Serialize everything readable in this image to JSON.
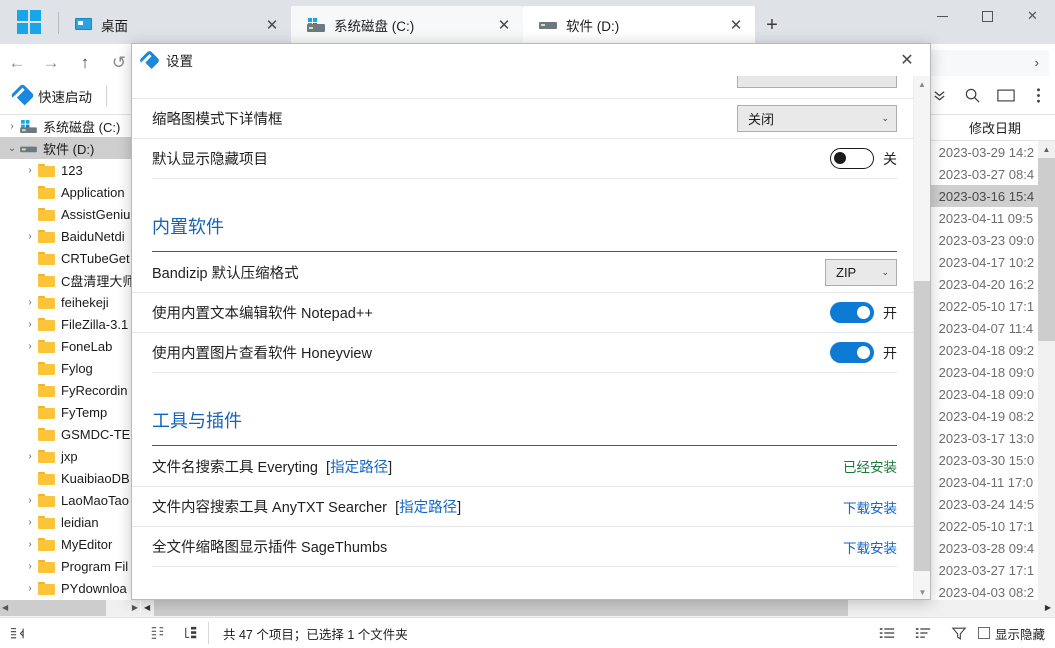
{
  "window": {
    "logo": "windows-grid-logo",
    "tabs": [
      {
        "label": "桌面",
        "icon": "desktop-icon",
        "state": "inactive",
        "close": "✕"
      },
      {
        "label": "系统磁盘 (C:)",
        "icon": "system-drive-icon",
        "state": "inactive-hl",
        "close": "✕"
      },
      {
        "label": "软件 (D:)",
        "icon": "drive-icon",
        "state": "active",
        "close": "✕"
      }
    ],
    "new_tab_label": "+",
    "controls": {
      "minimize": "minimize-icon",
      "maximize": "maximize-icon",
      "close": "✕"
    }
  },
  "toolbar": {
    "back": "←",
    "forward": "→",
    "up": "↑",
    "refresh": "↺",
    "address_chevron": "›"
  },
  "quicklaunch": {
    "label": "快速启动",
    "icons": {
      "expand": "chevron-double-down-icon",
      "search": "search-icon",
      "preview": "preview-pane-icon",
      "more": "more-options-icon"
    }
  },
  "tree": {
    "items": [
      {
        "label": "系统磁盘 (C:)",
        "chev": "›",
        "depth": 0,
        "type": "drive",
        "selected": false
      },
      {
        "label": "软件 (D:)",
        "chev": "⌄",
        "depth": 0,
        "type": "drive",
        "selected": true
      },
      {
        "label": "123",
        "chev": "›",
        "depth": 1,
        "type": "folder",
        "selected": false
      },
      {
        "label": "Application",
        "chev": "",
        "depth": 1,
        "type": "folder",
        "selected": false
      },
      {
        "label": "AssistGeniu",
        "chev": "",
        "depth": 1,
        "type": "folder",
        "selected": false
      },
      {
        "label": "BaiduNetdi",
        "chev": "›",
        "depth": 1,
        "type": "folder",
        "selected": false
      },
      {
        "label": "CRTubeGet",
        "chev": "",
        "depth": 1,
        "type": "folder",
        "selected": false
      },
      {
        "label": "C盘清理大师",
        "chev": "",
        "depth": 1,
        "type": "folder",
        "selected": false
      },
      {
        "label": "feihekeji",
        "chev": "›",
        "depth": 1,
        "type": "folder",
        "selected": false
      },
      {
        "label": "FileZilla-3.1",
        "chev": "›",
        "depth": 1,
        "type": "folder",
        "selected": false
      },
      {
        "label": "FoneLab",
        "chev": "›",
        "depth": 1,
        "type": "folder",
        "selected": false
      },
      {
        "label": "Fylog",
        "chev": "",
        "depth": 1,
        "type": "folder",
        "selected": false
      },
      {
        "label": "FyRecordin",
        "chev": "",
        "depth": 1,
        "type": "folder",
        "selected": false
      },
      {
        "label": "FyTemp",
        "chev": "",
        "depth": 1,
        "type": "folder",
        "selected": false
      },
      {
        "label": "GSMDC-TE",
        "chev": "",
        "depth": 1,
        "type": "folder",
        "selected": false
      },
      {
        "label": "jxp",
        "chev": "›",
        "depth": 1,
        "type": "folder",
        "selected": false
      },
      {
        "label": "KuaibiaoDB",
        "chev": "",
        "depth": 1,
        "type": "folder",
        "selected": false
      },
      {
        "label": "LaoMaoTao",
        "chev": "›",
        "depth": 1,
        "type": "folder",
        "selected": false
      },
      {
        "label": "leidian",
        "chev": "›",
        "depth": 1,
        "type": "folder",
        "selected": false
      },
      {
        "label": "MyEditor",
        "chev": "›",
        "depth": 1,
        "type": "folder",
        "selected": false
      },
      {
        "label": "Program Fil",
        "chev": "›",
        "depth": 1,
        "type": "folder",
        "selected": false
      },
      {
        "label": "PYdownloa",
        "chev": "›",
        "depth": 1,
        "type": "folder",
        "selected": false
      }
    ]
  },
  "filelist": {
    "columns": {
      "name": "",
      "date": "修改日期"
    },
    "rows": [
      {
        "date": "2023-03-29  14:2",
        "selected": false
      },
      {
        "date": "2023-03-27  08:4",
        "selected": false
      },
      {
        "date": "2023-03-16  15:4",
        "selected": true
      },
      {
        "date": "2023-04-11  09:5",
        "selected": false
      },
      {
        "date": "2023-03-23  09:0",
        "selected": false
      },
      {
        "date": "2023-04-17  10:2",
        "selected": false
      },
      {
        "date": "2023-04-20  16:2",
        "selected": false
      },
      {
        "date": "2022-05-10  17:1",
        "selected": false
      },
      {
        "date": "2023-04-07  11:4",
        "selected": false
      },
      {
        "date": "2023-04-18  09:2",
        "selected": false
      },
      {
        "date": "2023-04-18  09:0",
        "selected": false
      },
      {
        "date": "2023-04-18  09:0",
        "selected": false
      },
      {
        "date": "2023-04-19  08:2",
        "selected": false
      },
      {
        "date": "2023-03-17  13:0",
        "selected": false
      },
      {
        "date": "2023-03-30  15:0",
        "selected": false
      },
      {
        "date": "2023-04-11  17:0",
        "selected": false
      },
      {
        "date": "2023-03-24  14:5",
        "selected": false
      },
      {
        "date": "2022-05-10  17:1",
        "selected": false
      },
      {
        "date": "2023-03-28  09:4",
        "selected": false
      },
      {
        "date": "2023-03-27  17:1",
        "selected": false
      },
      {
        "date": "2023-04-03  08:2",
        "selected": false
      }
    ]
  },
  "statusbar": {
    "text": "共 47 个项目；已选择 1 个文件夹",
    "icons": {
      "collapse": "collapse-icon",
      "detail_pane": "detail-pane-icon",
      "tree_view": "tree-view-icon",
      "list_view": "list-view-icon",
      "sort": "sort-icon",
      "filter": "filter-icon"
    },
    "show_hidden_label": "显示隐藏"
  },
  "settings_dialog": {
    "title": "设置",
    "close": "✕",
    "rows_top": [
      {
        "label": "缩略图模式下详情框",
        "control": "select",
        "value": "关闭"
      },
      {
        "label": "默认显示隐藏项目",
        "control": "toggle",
        "toggle_state": "off",
        "toggle_text": "关"
      }
    ],
    "sections": [
      {
        "title": "内置软件",
        "rows": [
          {
            "label": "Bandizip 默认压缩格式",
            "control": "select-small",
            "value": "ZIP"
          },
          {
            "label": "使用内置文本编辑软件 Notepad++",
            "control": "toggle",
            "toggle_state": "on",
            "toggle_text": "开"
          },
          {
            "label": "使用内置图片查看软件 Honeyview",
            "control": "toggle",
            "toggle_state": "on",
            "toggle_text": "开"
          }
        ]
      },
      {
        "title": "工具与插件",
        "rows": [
          {
            "label": "文件名搜索工具 Everyting",
            "link": "指定路径",
            "control": "status",
            "status": "已经安装",
            "status_kind": "installed"
          },
          {
            "label": "文件内容搜索工具 AnyTXT Searcher",
            "link": "指定路径",
            "control": "status",
            "status": "下载安装",
            "status_kind": "download"
          },
          {
            "label": "全文件缩略图显示插件 SageThumbs",
            "link": "",
            "control": "status",
            "status": "下载安装",
            "status_kind": "download"
          }
        ]
      }
    ],
    "scrollbar": {
      "up": "▲",
      "down": "▼"
    }
  },
  "colors": {
    "accent_blue": "#0d7bd4",
    "section_heading": "#1463b8",
    "link_blue": "#1266c4",
    "installed_green": "#1a7a3c",
    "titlebar_bg": "#dfe3e8",
    "selection_gray": "#cfcfcf"
  }
}
